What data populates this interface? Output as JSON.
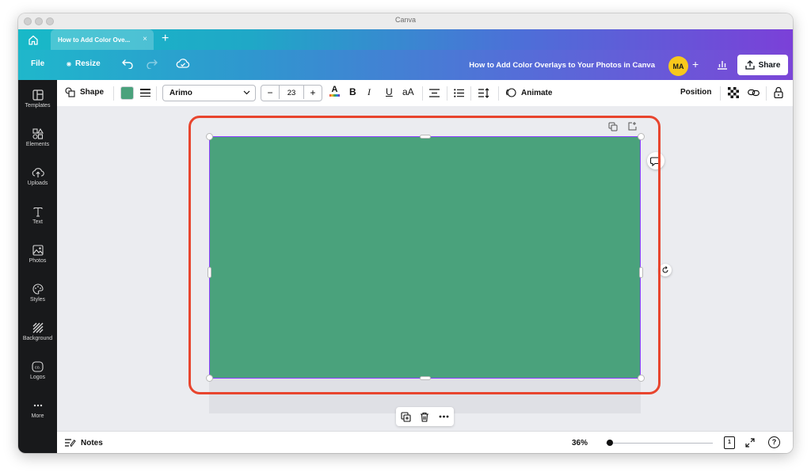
{
  "window": {
    "title": "Canva"
  },
  "tabs": {
    "home_icon": "home-icon",
    "active_label": "How to Add Color Ove...",
    "close": "×",
    "new_tab": "+"
  },
  "menubar": {
    "file": "File",
    "resize": "Resize",
    "doc_title": "How to Add Color Overlays to Your Photos in Canva",
    "avatar": "MA",
    "add": "+",
    "share": "Share"
  },
  "sidebar": {
    "items": [
      {
        "label": "Templates",
        "icon": "templates-icon"
      },
      {
        "label": "Elements",
        "icon": "elements-icon"
      },
      {
        "label": "Uploads",
        "icon": "uploads-icon"
      },
      {
        "label": "Text",
        "icon": "text-icon"
      },
      {
        "label": "Photos",
        "icon": "photos-icon"
      },
      {
        "label": "Styles",
        "icon": "styles-icon"
      },
      {
        "label": "Background",
        "icon": "background-icon"
      },
      {
        "label": "Logos",
        "icon": "logos-icon"
      },
      {
        "label": "More",
        "icon": "more-icon"
      }
    ]
  },
  "toolbar": {
    "shape": "Shape",
    "color": "#4aa27c",
    "font": "Arimo",
    "minus": "−",
    "font_size": "23",
    "plus": "+",
    "text_color_letter": "A",
    "bold": "B",
    "italic": "I",
    "underline": "U",
    "case": "aA",
    "animate": "Animate",
    "position": "Position"
  },
  "canvas": {
    "fill": "#4aa27c",
    "highlight": "#e8452e",
    "selection": "#8b3dff"
  },
  "footer": {
    "notes": "Notes",
    "zoom": "36%",
    "zoom_level": 0.36,
    "page_count": "1",
    "help": "?"
  }
}
